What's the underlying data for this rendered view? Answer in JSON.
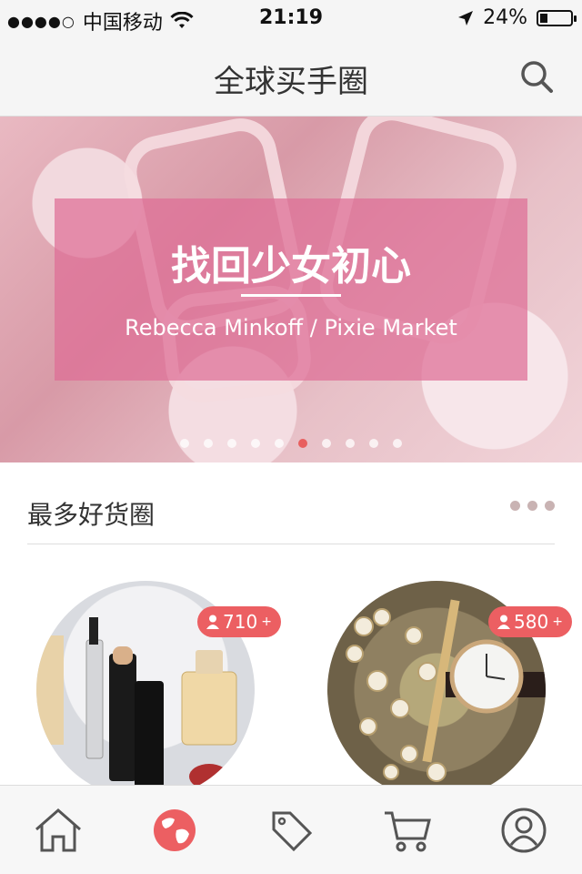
{
  "status_bar": {
    "signal": "●●●●○",
    "carrier": "中国移动",
    "wifi_icon": "wifi-icon",
    "time": "21:19",
    "location_icon": "location-arrow-icon",
    "battery": "24%"
  },
  "navbar": {
    "title": "全球买手圈",
    "search_icon": "search-icon"
  },
  "banner": {
    "headline": "找回少女初心",
    "subtitle": "Rebecca Minkoff / Pixie Market",
    "page_count": 10,
    "active_page": 5
  },
  "section": {
    "title": "最多好货圈",
    "more_icon": "more-dots-icon"
  },
  "cards": [
    {
      "count": "710",
      "plus": "+",
      "image": "cosmetics-perfume"
    },
    {
      "count": "580",
      "plus": "+",
      "image": "watch-pearl-bracelets"
    }
  ],
  "tabbar": [
    {
      "icon": "home-icon",
      "active": false
    },
    {
      "icon": "globe-icon",
      "active": true
    },
    {
      "icon": "tag-icon",
      "active": false
    },
    {
      "icon": "cart-icon",
      "active": false
    },
    {
      "icon": "profile-icon",
      "active": false
    }
  ],
  "colors": {
    "accent": "#ec5f62",
    "overlay": "#de6e96",
    "bar_bg": "#f5f5f5"
  }
}
